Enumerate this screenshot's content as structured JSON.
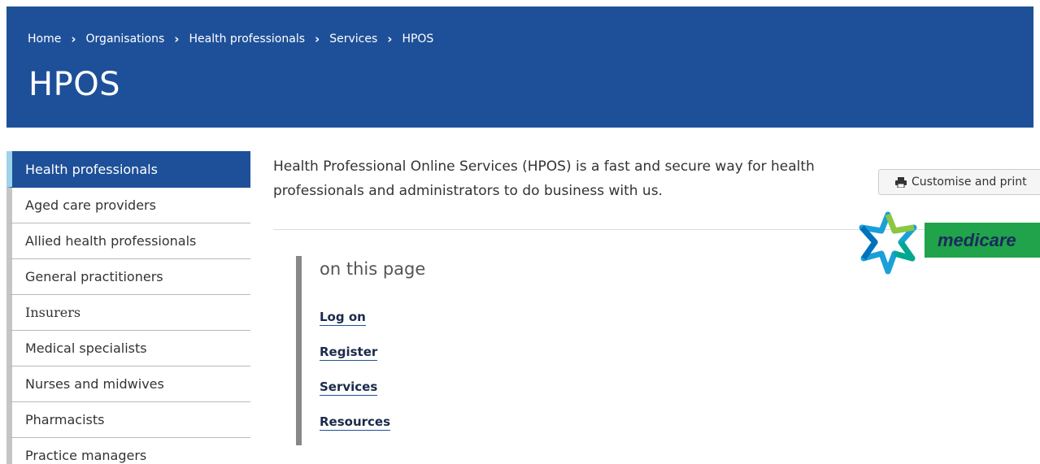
{
  "header": {
    "breadcrumb": [
      {
        "label": "Home"
      },
      {
        "label": "Organisations"
      },
      {
        "label": "Health professionals"
      },
      {
        "label": "Services"
      },
      {
        "label": "HPOS"
      }
    ],
    "title": "HPOS"
  },
  "sidebar": {
    "items": [
      {
        "label": "Health professionals",
        "active": true
      },
      {
        "label": "Aged care providers"
      },
      {
        "label": "Allied health professionals"
      },
      {
        "label": "General practitioners"
      },
      {
        "label": "Insurers"
      },
      {
        "label": "Medical specialists"
      },
      {
        "label": "Nurses and midwives"
      },
      {
        "label": "Pharmacists"
      },
      {
        "label": "Practice managers"
      }
    ]
  },
  "main": {
    "intro": "Health Professional Online Services (HPOS) is a fast and secure way for health professionals and administrators to do business with us.",
    "on_this_page": {
      "heading": "on this page",
      "links": [
        "Log on",
        "Register",
        "Services",
        "Resources"
      ]
    },
    "print_button_label": "Customise and print",
    "logo_text": "medicare"
  },
  "colors": {
    "brand_blue": "#1e5099",
    "active_accent": "#9fd3ea",
    "medicare_green": "#20a34a"
  }
}
